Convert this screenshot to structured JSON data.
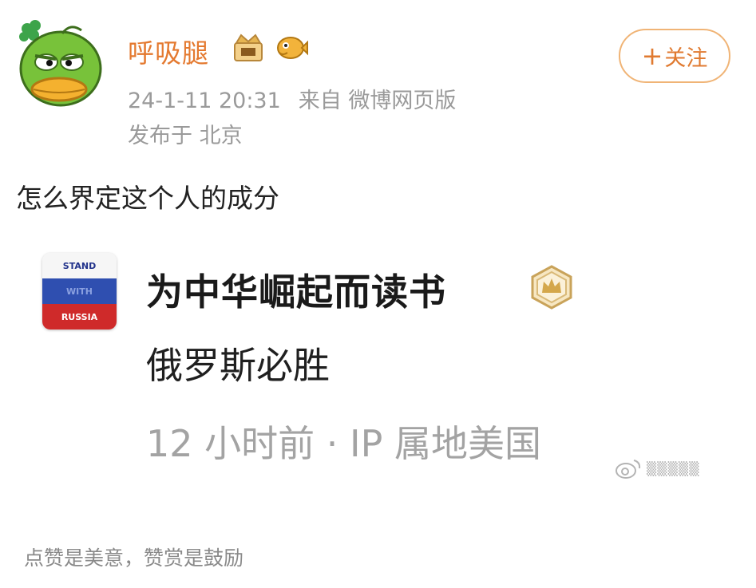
{
  "post": {
    "author": "呼吸腿",
    "timestamp": "24-1-11 20:31",
    "source": "来自 微博网页版",
    "location": "发布于 北京",
    "follow_label": "关注",
    "text": "怎么界定这个人的成分"
  },
  "quoted": {
    "flag_lines": [
      "STAND",
      "WITH",
      "RUSSIA"
    ],
    "name": "为中华崛起而读书",
    "text": "俄罗斯必胜",
    "meta": "12 小时前 · IP 属地美国"
  },
  "footer": {
    "text": "点赞是美意，赞赏是鼓励"
  },
  "icons": {
    "avatar": "duck-avatar",
    "badge1": "crown-badge-icon",
    "badge2": "pufferfish-icon",
    "verified": "crown-hexagon-icon",
    "watermark": "weibo-logo-icon"
  },
  "colors": {
    "accent": "#e07a30",
    "username": "#e4792f",
    "meta": "#9a9a9a",
    "follow_border": "#f0b476"
  }
}
